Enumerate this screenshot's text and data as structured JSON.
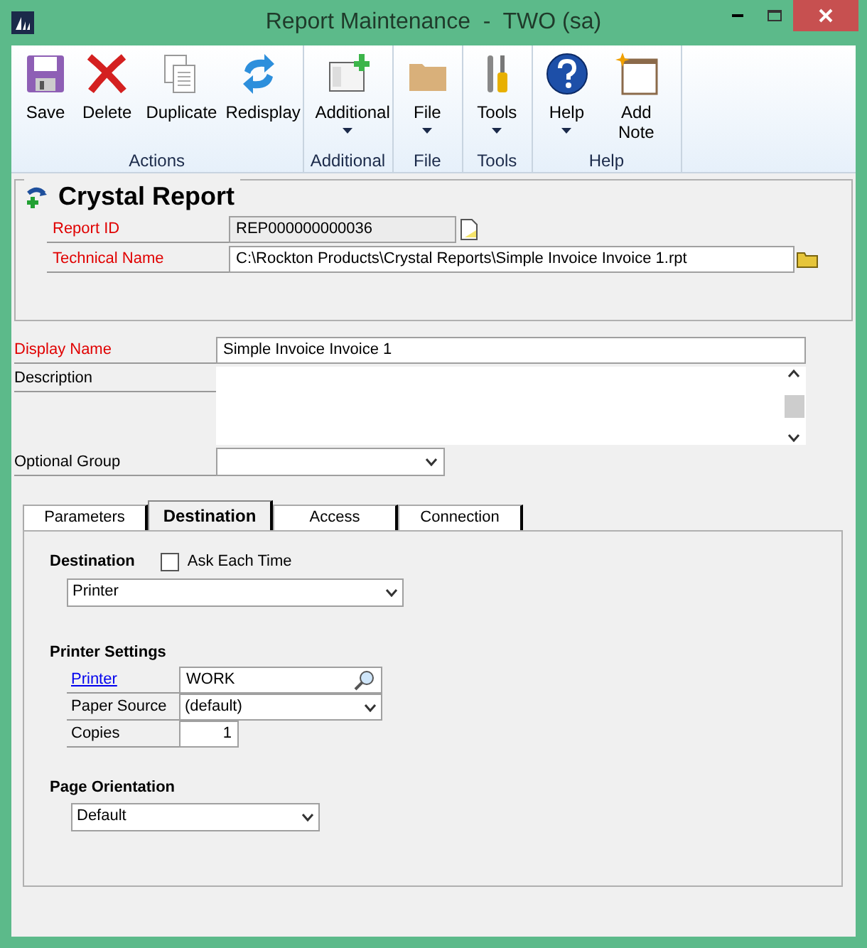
{
  "window": {
    "title": "Report Maintenance  -  TWO (sa)"
  },
  "ribbon": {
    "groups": [
      {
        "label": "Actions",
        "buttons": [
          {
            "label": "Save",
            "dropdown": false
          },
          {
            "label": "Delete",
            "dropdown": false
          },
          {
            "label": "Duplicate",
            "dropdown": false
          },
          {
            "label": "Redisplay",
            "dropdown": false
          }
        ]
      },
      {
        "label": "Additional",
        "buttons": [
          {
            "label": "Additional",
            "dropdown": true
          }
        ]
      },
      {
        "label": "File",
        "buttons": [
          {
            "label": "File",
            "dropdown": true
          }
        ]
      },
      {
        "label": "Tools",
        "buttons": [
          {
            "label": "Tools",
            "dropdown": true
          }
        ]
      },
      {
        "label": "Help",
        "buttons": [
          {
            "label": "Help",
            "dropdown": true
          },
          {
            "label": "Add Note",
            "dropdown": false
          }
        ]
      }
    ]
  },
  "header": {
    "title": "Crystal Report",
    "fields": [
      {
        "label": "Report ID",
        "value": "REP000000000036",
        "required": true
      },
      {
        "label": "Technical Name",
        "value": "C:\\Rockton Products\\Crystal Reports\\Simple Invoice Invoice 1.rpt",
        "required": true
      }
    ]
  },
  "display_name": {
    "label": "Display Name",
    "value": "Simple Invoice Invoice 1",
    "required": true
  },
  "description": {
    "label": "Description",
    "required": false
  },
  "optional_group": {
    "label": "Optional Group",
    "required": false
  },
  "tabs": [
    {
      "label": "Parameters",
      "selected": false
    },
    {
      "label": "Destination",
      "selected": true
    },
    {
      "label": "Access",
      "selected": false
    },
    {
      "label": "Connection",
      "selected": false
    }
  ],
  "destination": {
    "label": "Destination",
    "ask_each_time": {
      "label": "Ask Each Time",
      "checked": false
    },
    "value": "Printer"
  },
  "printer_settings": {
    "title": "Printer Settings",
    "printer": {
      "label": "Printer",
      "value": "WORK"
    },
    "paper_source": {
      "label": "Paper Source",
      "value": "(default)"
    },
    "copies": {
      "label": "Copies",
      "value": "1"
    }
  },
  "page_orientation": {
    "title": "Page Orientation",
    "value": "Default"
  }
}
